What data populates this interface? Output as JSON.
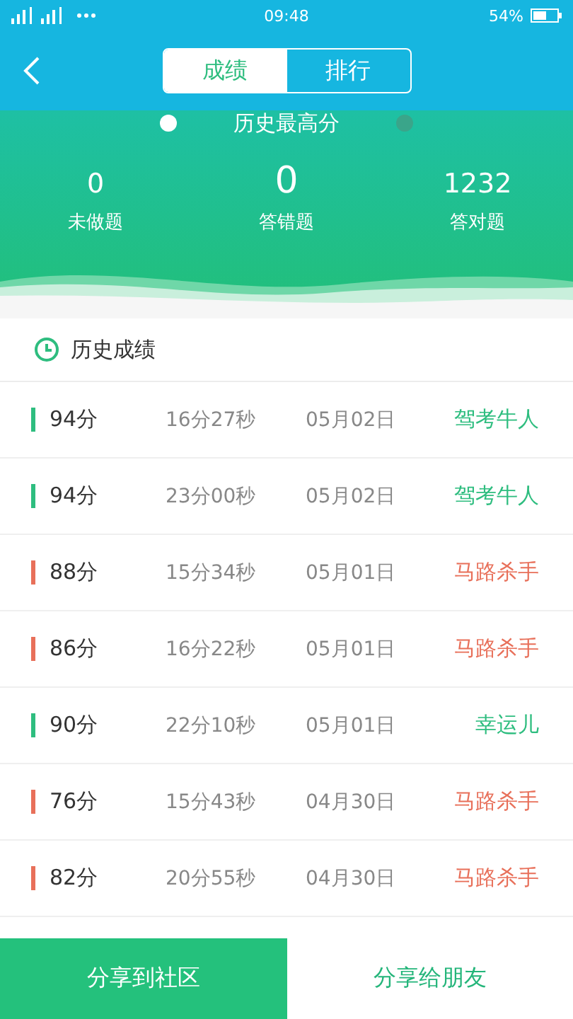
{
  "status_bar": {
    "time": "09:48",
    "battery": "54%"
  },
  "tabs": [
    {
      "label": "成绩",
      "selected": true
    },
    {
      "label": "排行",
      "selected": false
    }
  ],
  "summary": {
    "title": "历史最高分",
    "stats": [
      {
        "value": "0",
        "label": "未做题",
        "emphasized": false
      },
      {
        "value": "0",
        "label": "答错题",
        "emphasized": true
      },
      {
        "value": "1232",
        "label": "答对题",
        "emphasized": false
      }
    ]
  },
  "history": {
    "title": "历史成绩",
    "rows": [
      {
        "score": "94分",
        "duration": "16分27秒",
        "date": "05月02日",
        "rank": "驾考牛人",
        "color": "#2ebd7f"
      },
      {
        "score": "94分",
        "duration": "23分00秒",
        "date": "05月02日",
        "rank": "驾考牛人",
        "color": "#2ebd7f"
      },
      {
        "score": "88分",
        "duration": "15分34秒",
        "date": "05月01日",
        "rank": "马路杀手",
        "color": "#e8705a"
      },
      {
        "score": "86分",
        "duration": "16分22秒",
        "date": "05月01日",
        "rank": "马路杀手",
        "color": "#e8705a"
      },
      {
        "score": "90分",
        "duration": "22分10秒",
        "date": "05月01日",
        "rank": "幸运儿",
        "color": "#2ebd7f"
      },
      {
        "score": "76分",
        "duration": "15分43秒",
        "date": "04月30日",
        "rank": "马路杀手",
        "color": "#e8705a"
      },
      {
        "score": "82分",
        "duration": "20分55秒",
        "date": "04月30日",
        "rank": "马路杀手",
        "color": "#e8705a"
      }
    ]
  },
  "buttons": [
    {
      "label": "分享到社区",
      "kind": "primary"
    },
    {
      "label": "分享给朋友",
      "kind": "secondary"
    }
  ]
}
